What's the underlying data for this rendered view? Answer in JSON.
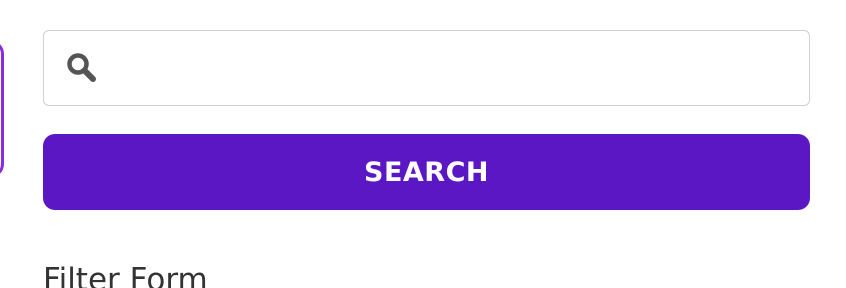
{
  "search": {
    "icon": "search-icon",
    "value": "",
    "placeholder": "",
    "button_label": "SEARCH"
  },
  "filter": {
    "heading": "Filter Form"
  },
  "colors": {
    "button_background": "#5b17c4",
    "button_text": "#ffffff",
    "accent_edge": "#8a2be2",
    "icon": "#555555",
    "input_border": "#cfcfcf"
  }
}
